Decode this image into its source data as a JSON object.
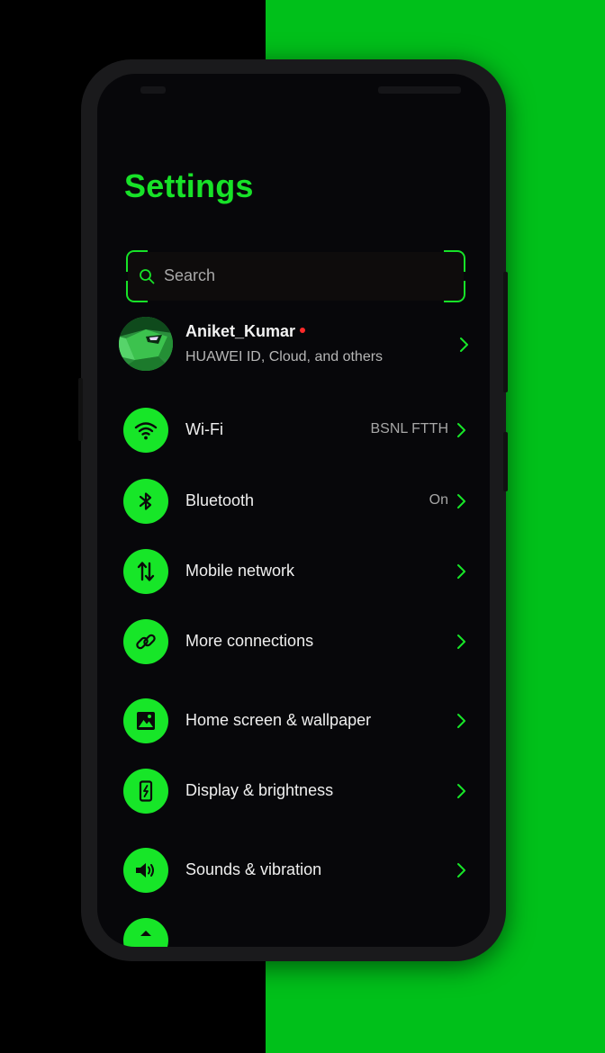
{
  "settings": {
    "title": "Settings",
    "search_placeholder": "Search"
  },
  "account": {
    "name": "Aniket_Kumar",
    "subtitle": "HUAWEI ID, Cloud, and others"
  },
  "items": [
    {
      "label": "Wi-Fi",
      "value": "BSNL FTTH",
      "icon": "wifi-icon"
    },
    {
      "label": "Bluetooth",
      "value": "On",
      "icon": "bluetooth-icon"
    },
    {
      "label": "Mobile network",
      "value": "",
      "icon": "mobile-data-icon"
    },
    {
      "label": "More connections",
      "value": "",
      "icon": "link-icon"
    },
    {
      "label": "Home screen & wallpaper",
      "value": "",
      "icon": "image-icon"
    },
    {
      "label": "Display & brightness",
      "value": "",
      "icon": "display-icon"
    },
    {
      "label": "Sounds & vibration",
      "value": "",
      "icon": "speaker-icon"
    }
  ],
  "colors": {
    "accent": "#17e628",
    "screen_bg": "#07070a",
    "background_right": "#00c01a",
    "background_left": "#000000",
    "notification_dot": "#ff2a2a"
  }
}
